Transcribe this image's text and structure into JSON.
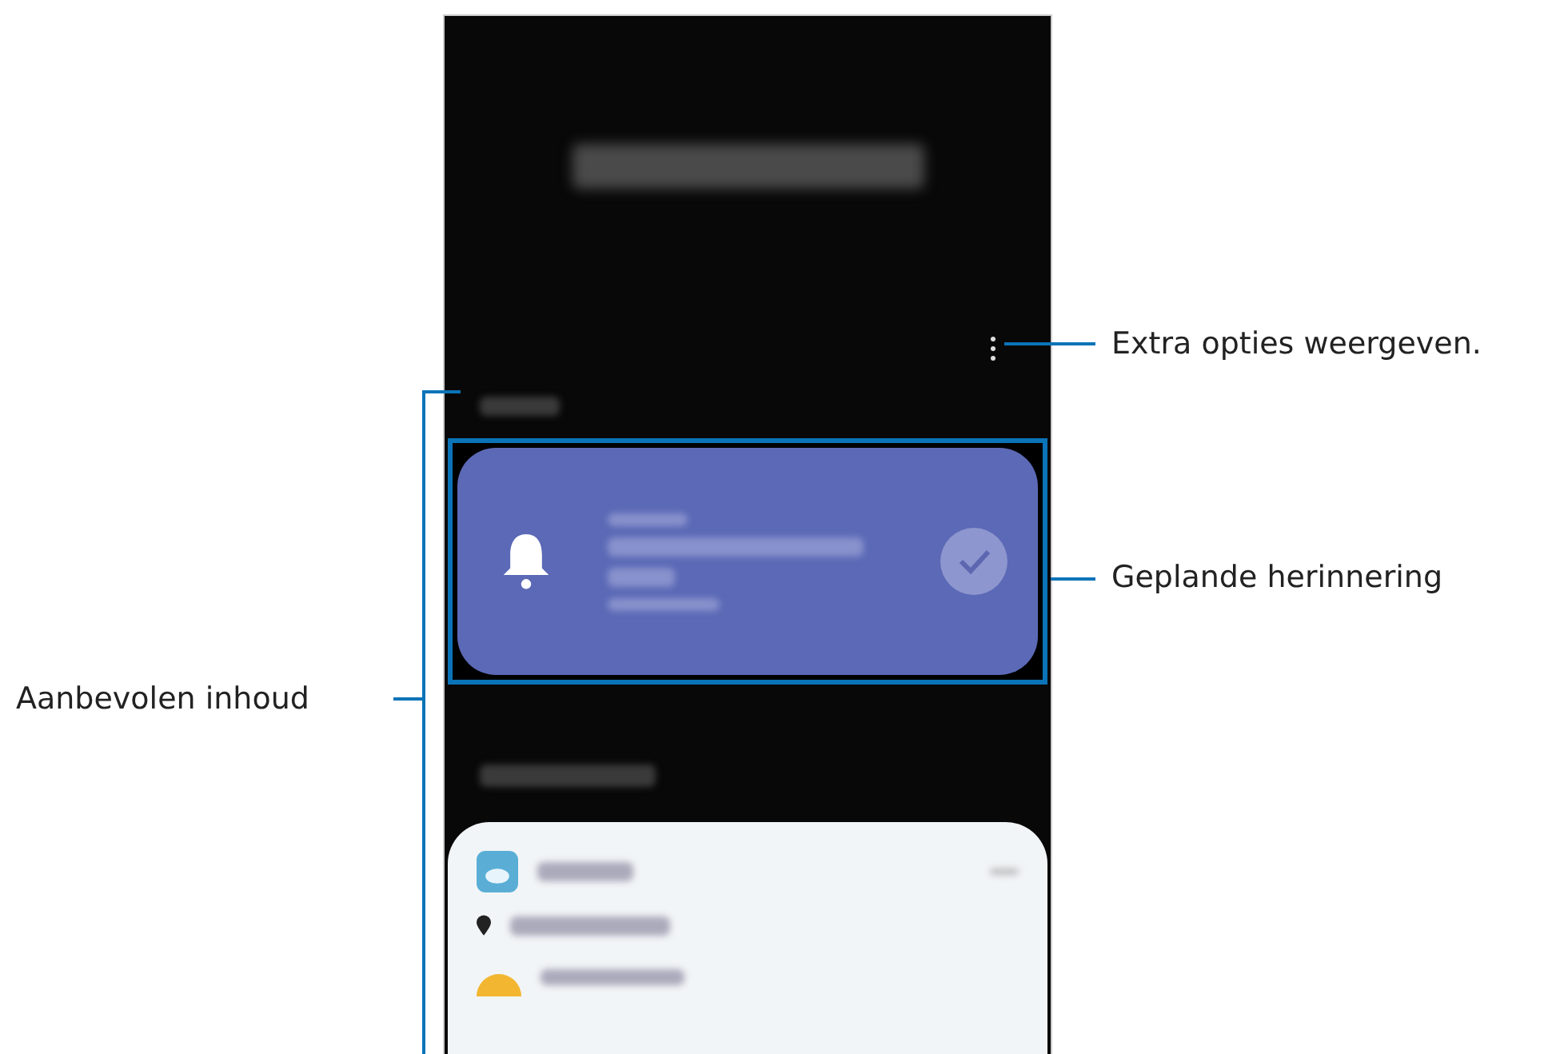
{
  "callouts": [
    {
      "label": "Extra opties weergeven.",
      "kind": "right"
    },
    {
      "label": "Geplande herinnering",
      "kind": "right"
    },
    {
      "label": "Aanbevolen inhoud",
      "kind": "left"
    }
  ]
}
